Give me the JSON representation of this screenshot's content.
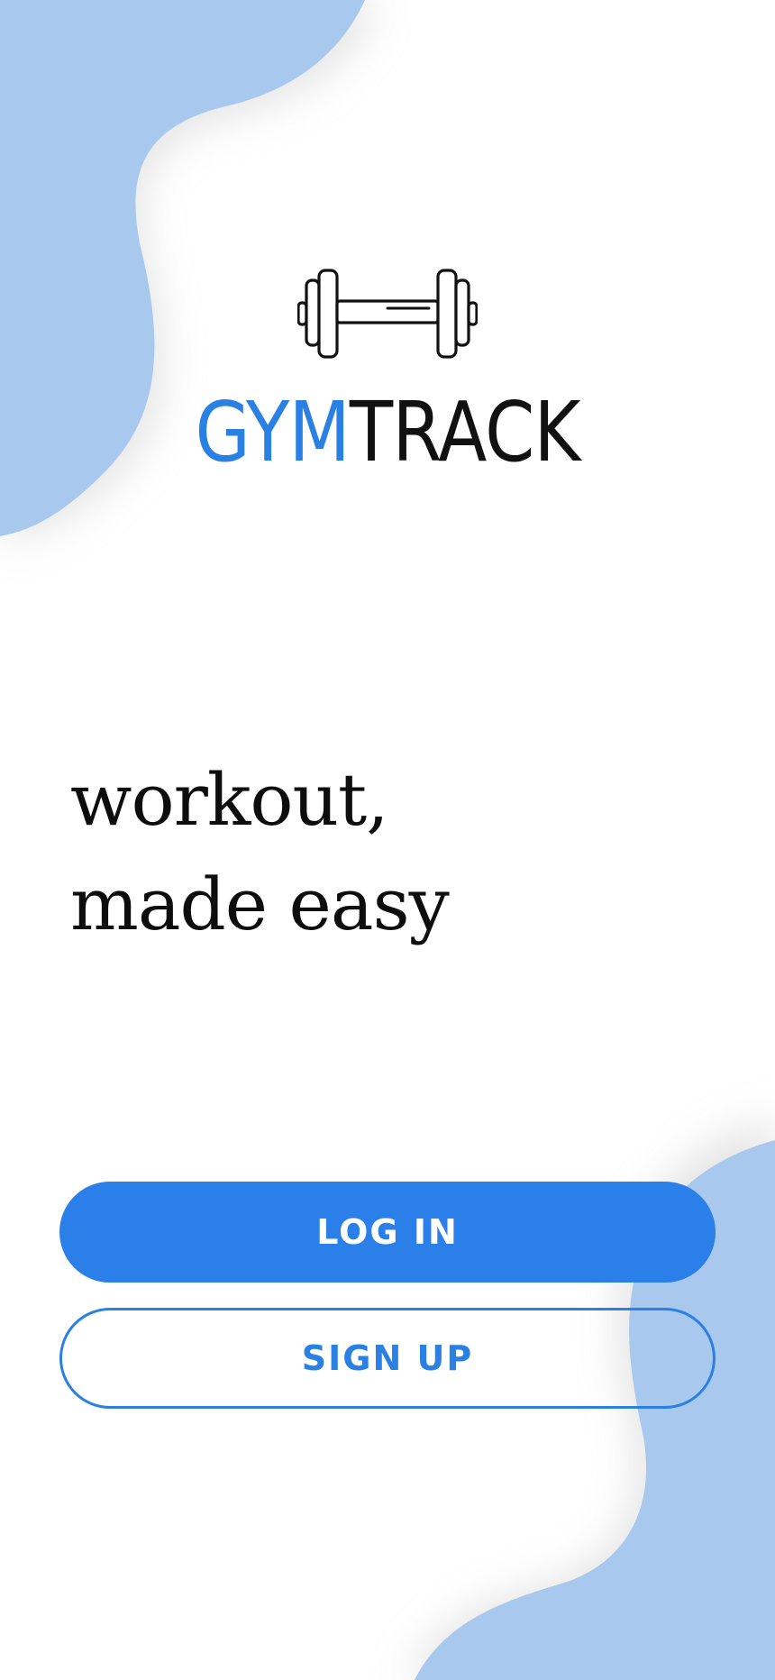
{
  "brand": {
    "name_accent": "GYM",
    "name_rest": "TRACK",
    "accent_color": "#2a80e3",
    "logo_icon": "dumbbell-icon"
  },
  "tagline": {
    "line1": "workout,",
    "line2": "made easy"
  },
  "actions": {
    "login_label": "LOG IN",
    "signup_label": "SIGN UP"
  },
  "colors": {
    "primary": "#2a80e8",
    "blob": "#a9c8ee",
    "background": "#ffffff"
  }
}
